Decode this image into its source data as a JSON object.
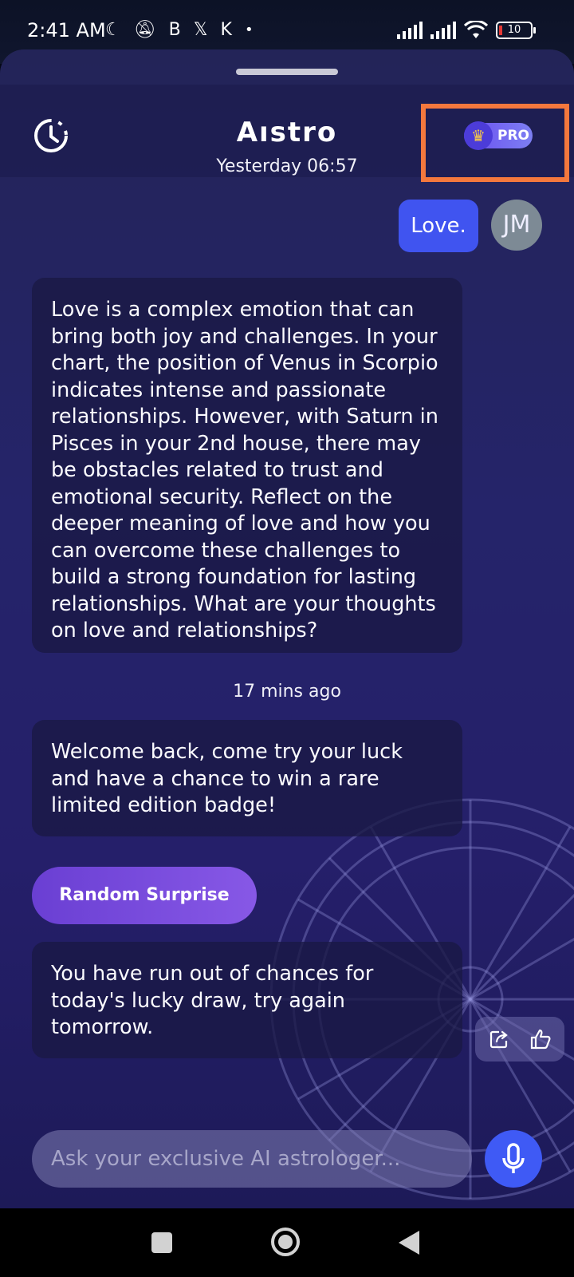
{
  "status_bar": {
    "time": "2:41 AM",
    "icons": [
      "moon-icon",
      "bell-off-icon",
      "b-app-icon",
      "x-app-icon",
      "k-app-icon",
      "dot-icon"
    ],
    "battery": "10"
  },
  "header": {
    "title": "Aıstro",
    "pro_label": "PRO",
    "crown_glyph": "♛"
  },
  "chat": {
    "timestamp_1": "Yesterday 06:57",
    "user_message": "Love.",
    "user_initials": "JM",
    "bot_message_1": "Love is a complex emotion that can bring both joy and challenges. In your chart, the position of Venus in Scorpio indicates intense and passionate relationships. However, with Saturn in Pisces in your 2nd house, there may be obstacles related to trust and emotional security. Reflect on the deeper meaning of love and how you can overcome these challenges to build a strong foundation for lasting relationships. What are your thoughts on love and relationships?",
    "timestamp_2": "17 mins ago",
    "bot_message_2": "Welcome back, come try your luck and have a chance to win a rare limited edition badge!",
    "surprise_button": "Random Surprise",
    "bot_message_3": "You have run out of chances for today's lucky draw, try again tomorrow."
  },
  "input": {
    "placeholder": "Ask your exclusive AI astrologer...",
    "value": ""
  },
  "colors": {
    "accent": "#4054f0",
    "highlight": "#f4783d",
    "surprise": "#7a4be0"
  }
}
